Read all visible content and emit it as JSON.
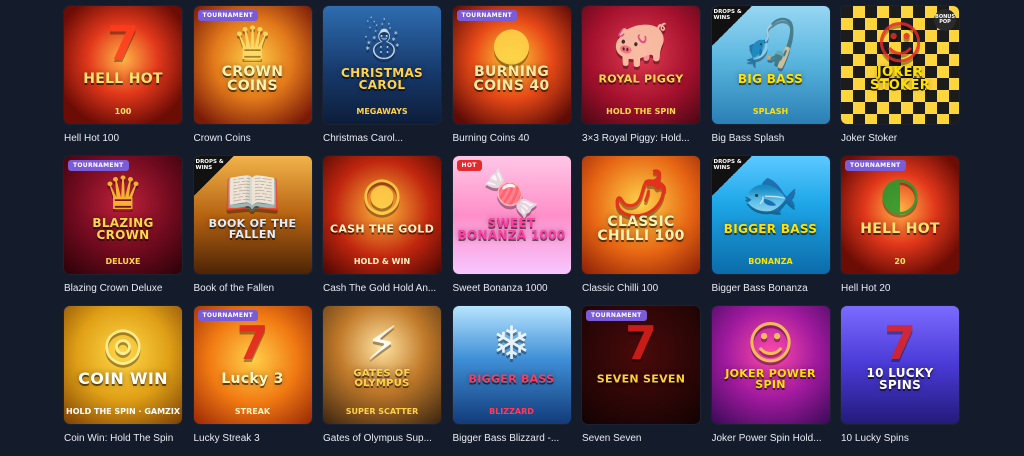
{
  "games": [
    {
      "title": "Hell Hot 100",
      "badge": null,
      "art": "HELL HOT",
      "art_sub": "100",
      "icon": "seven-icon",
      "theme": "hellhot"
    },
    {
      "title": "Crown Coins",
      "badge": "TOURNAMENT",
      "art": "CROWN COINS",
      "art_sub": "",
      "icon": "crown-icon",
      "theme": "crowncoins"
    },
    {
      "title": "Christmas Carol...",
      "badge": null,
      "art": "CHRISTMAS CAROL",
      "art_sub": "MEGAWAYS",
      "icon": "character-icon",
      "theme": "christmas"
    },
    {
      "title": "Burning Coins 40",
      "badge": "TOURNAMENT",
      "art": "BURNING COINS 40",
      "art_sub": "",
      "icon": "coin-icon",
      "theme": "burning"
    },
    {
      "title": "3×3 Royal Piggy: Hold...",
      "badge": null,
      "art": "ROYAL PIGGY",
      "art_sub": "HOLD THE SPIN",
      "icon": "piggy-icon",
      "theme": "piggy"
    },
    {
      "title": "Big Bass Splash",
      "badge": "DROPS & WINS",
      "art": "BIG BASS",
      "art_sub": "SPLASH",
      "icon": "fisherman-icon",
      "theme": "bigbass"
    },
    {
      "title": "Joker Stoker",
      "badge": "BONUS POP",
      "art": "JOKER STOKER",
      "art_sub": "",
      "icon": "joker-icon",
      "theme": "jokerstoker"
    },
    {
      "title": "Blazing Crown Deluxe",
      "badge": "TOURNAMENT",
      "art": "BLAZING CROWN",
      "art_sub": "DELUXE",
      "icon": "crown-icon",
      "theme": "blazing"
    },
    {
      "title": "Book of the Fallen",
      "badge": "DROPS & WINS",
      "art": "BOOK OF THE FALLEN",
      "art_sub": "",
      "icon": "book-icon",
      "theme": "book"
    },
    {
      "title": "Cash The Gold Hold An...",
      "badge": null,
      "art": "CASH THE GOLD",
      "art_sub": "HOLD & WIN",
      "icon": "coin-icon",
      "theme": "cashgold"
    },
    {
      "title": "Sweet Bonanza 1000",
      "badge": "HOT",
      "art": "SWEET BONANZA 1000",
      "art_sub": "",
      "icon": "candy-icon",
      "theme": "sweet"
    },
    {
      "title": "Classic Chilli 100",
      "badge": null,
      "art": "CLASSIC CHILLI 100",
      "art_sub": "",
      "icon": "chilli-icon",
      "theme": "chilli"
    },
    {
      "title": "Bigger Bass Bonanza",
      "badge": "DROPS & WINS",
      "art": "BIGGER BASS",
      "art_sub": "BONANZA",
      "icon": "fish-icon",
      "theme": "biggerbass"
    },
    {
      "title": "Hell Hot 20",
      "badge": "TOURNAMENT",
      "art": "HELL HOT",
      "art_sub": "20",
      "icon": "watermelon-icon",
      "theme": "hellhot20"
    },
    {
      "title": "Coin Win: Hold The Spin",
      "badge": null,
      "art": "COIN WIN",
      "art_sub": "HOLD THE SPIN · GAMZIX",
      "icon": "coin-icon",
      "theme": "coinwin"
    },
    {
      "title": "Lucky Streak 3",
      "badge": "TOURNAMENT",
      "art": "Lucky 3",
      "art_sub": "STREAK",
      "icon": "seven-icon",
      "theme": "lucky3"
    },
    {
      "title": "Gates of Olympus Sup...",
      "badge": null,
      "art": "GATES OF OLYMPUS",
      "art_sub": "SUPER SCATTER",
      "icon": "zeus-icon",
      "theme": "olympus"
    },
    {
      "title": "Bigger Bass Blizzard -...",
      "badge": null,
      "art": "BIGGER BASS",
      "art_sub": "BLIZZARD",
      "icon": "fisherman-icon",
      "theme": "blizzard"
    },
    {
      "title": "Seven Seven",
      "badge": "TOURNAMENT",
      "art": "SEVEN SEVEN",
      "art_sub": "",
      "icon": "seven-icon",
      "theme": "sevenseven"
    },
    {
      "title": "Joker Power Spin Hold...",
      "badge": null,
      "art": "JOKER POWER SPIN",
      "art_sub": "",
      "icon": "joker-icon",
      "theme": "jokerpower"
    },
    {
      "title": "10 Lucky Spins",
      "badge": null,
      "art": "10 LUCKY SPINS",
      "art_sub": "",
      "icon": "seven-icon",
      "theme": "tenlucky"
    }
  ]
}
